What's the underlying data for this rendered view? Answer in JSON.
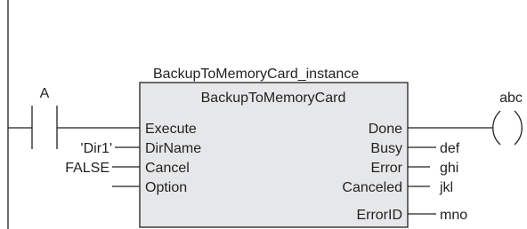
{
  "instance_name": "BackupToMemoryCard_instance",
  "function_block": {
    "name": "BackupToMemoryCard",
    "inputs": [
      "Execute",
      "DirName",
      "Cancel",
      "Option"
    ],
    "outputs": [
      "Done",
      "Busy",
      "Error",
      "Canceled",
      "ErrorID"
    ]
  },
  "contact": {
    "label": "A"
  },
  "input_values": {
    "dirname": "'Dir1'",
    "cancel": "FALSE"
  },
  "coil": {
    "label": "abc"
  },
  "output_values": {
    "busy": "def",
    "error": "ghi",
    "canceled": "jkl",
    "errorid": "mno"
  },
  "colors": {
    "line": "#231f20",
    "block_fill": "#e6e7e8"
  }
}
